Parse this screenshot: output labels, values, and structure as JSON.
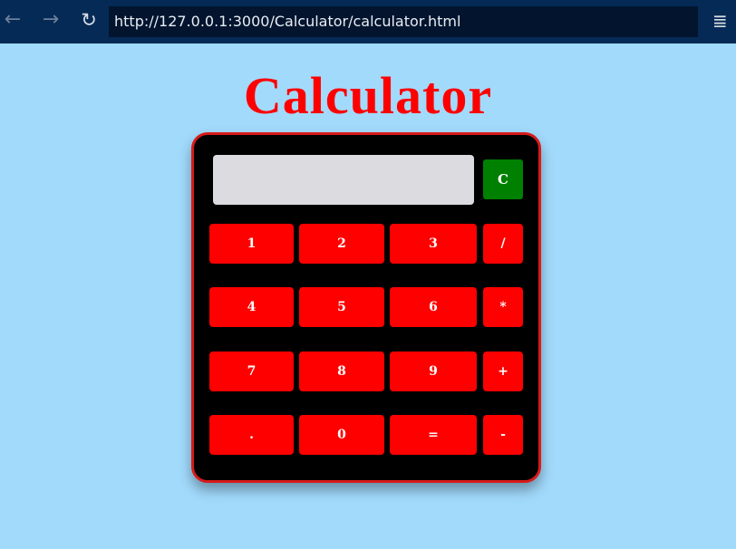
{
  "browser": {
    "url": "http://127.0.0.1:3000/Calculator/calculator.html",
    "back_icon": "←",
    "forward_icon": "→",
    "reload_icon": "↻",
    "menu_icon": "≣"
  },
  "page": {
    "title": "Calculator"
  },
  "calculator": {
    "display_value": "",
    "clear_label": "C",
    "keys": [
      [
        "1",
        "2",
        "3",
        "/"
      ],
      [
        "4",
        "5",
        "6",
        "*"
      ],
      [
        ".",
        "0",
        "=",
        "-"
      ]
    ],
    "row3": [
      "7",
      "8",
      "9",
      "+"
    ]
  },
  "colors": {
    "page_background": "#a2dafc",
    "title": "#ff0000",
    "calc_body": "#000000",
    "calc_border": "#d71a1a",
    "key": "#ff0000",
    "clear": "#008000",
    "display": "#dcdce0"
  }
}
